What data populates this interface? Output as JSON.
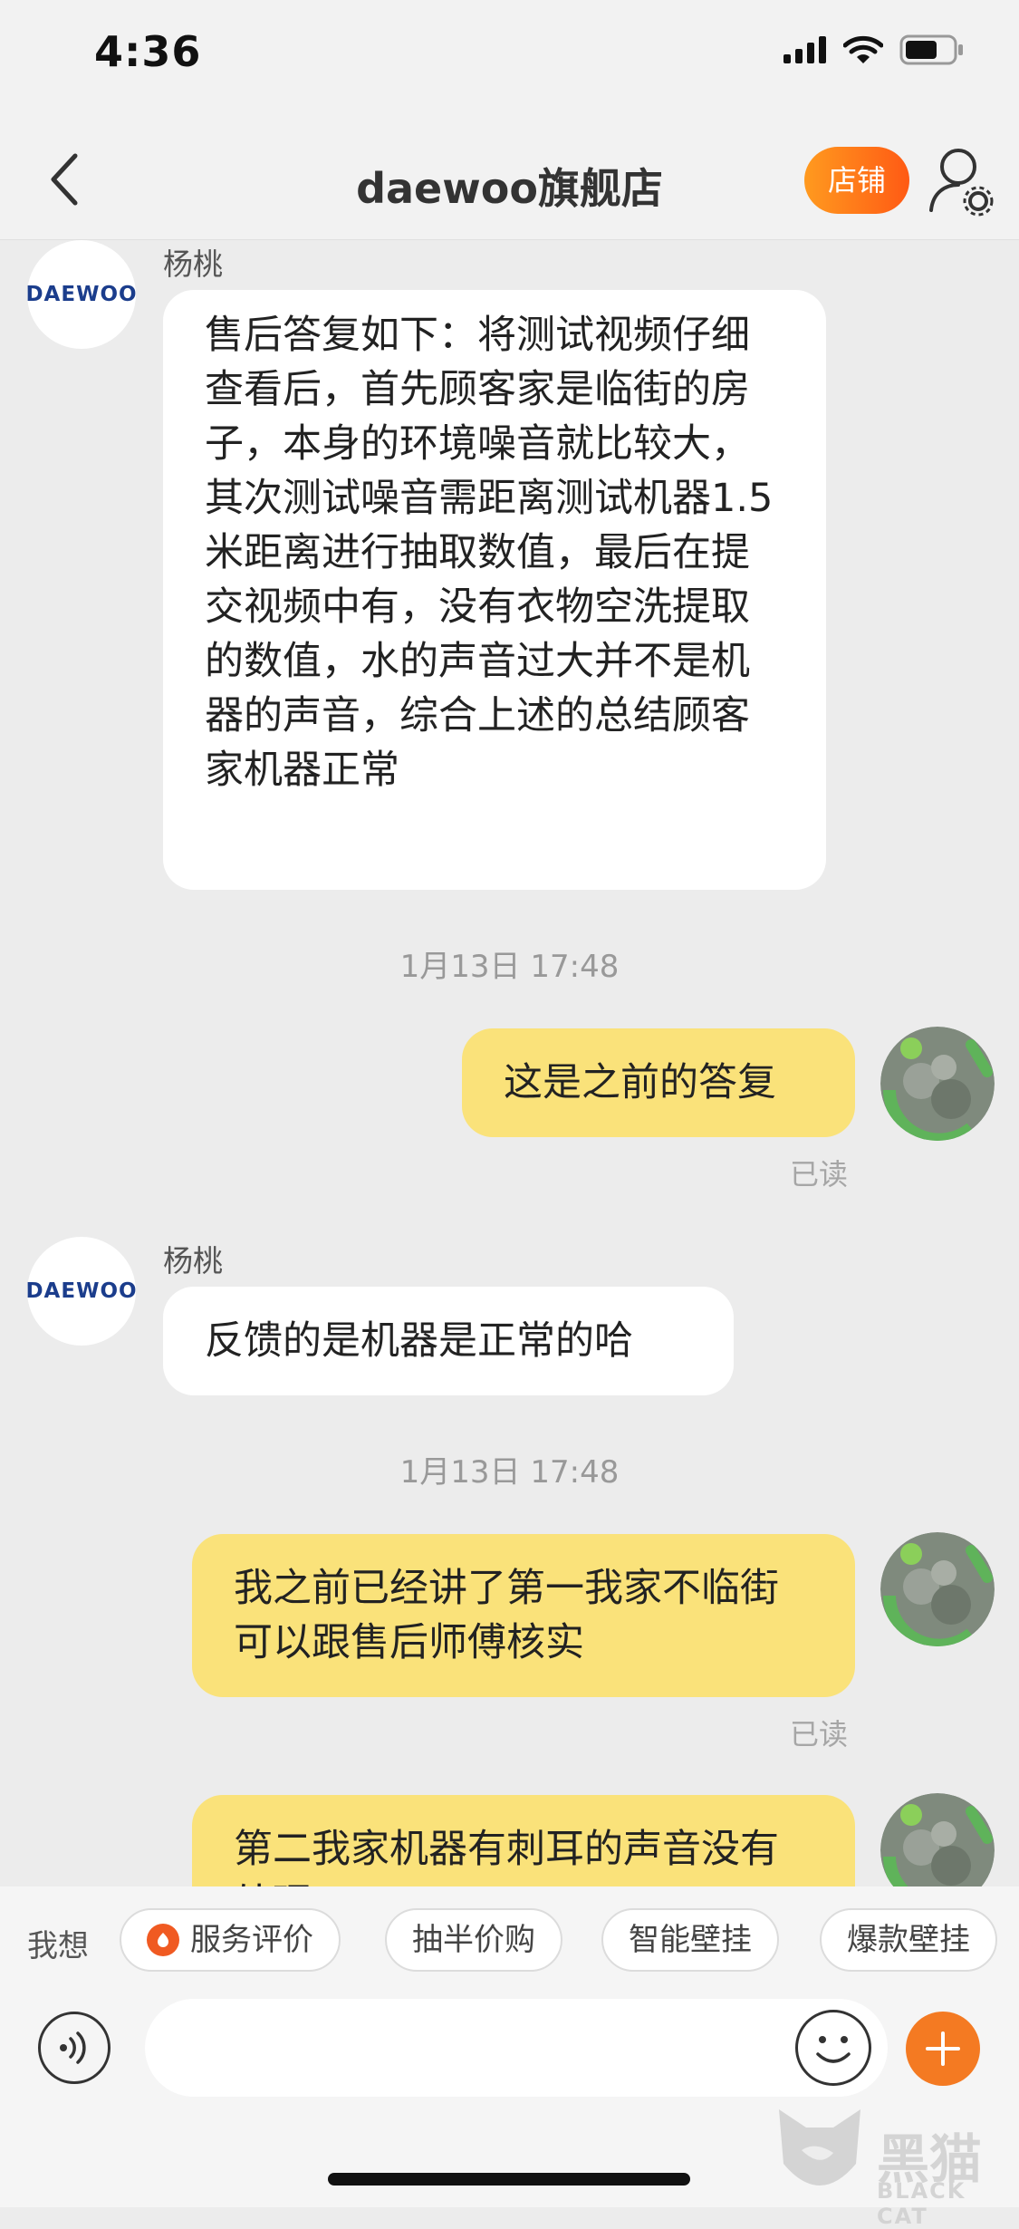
{
  "status_bar": {
    "time": "4:36"
  },
  "nav": {
    "title": "daewoo旗舰店",
    "store_button": "店铺"
  },
  "messages": [
    {
      "sender": "杨桃",
      "avatar_text": "DAEWOO",
      "text": "售后答复如下：将测试视频仔细查看后，首先顾客家是临街的房子，本身的环境噪音就比较大，其次测试噪音需距离测试机器1.5米距离进行抽取数值，最后在提交视频中有，没有衣物空洗提取的数值，水的声音过大并不是机器的声音，综合上述的总结顾客家机器正常"
    },
    {
      "timestamp": "1月13日 17:48"
    },
    {
      "text": "这是之前的答复",
      "read": "已读"
    },
    {
      "sender": "杨桃",
      "avatar_text": "DAEWOO",
      "text": "反馈的是机器是正常的哈"
    },
    {
      "timestamp": "1月13日 17:48"
    },
    {
      "text": "我之前已经讲了第一我家不临街 可以跟售后师傅核实",
      "read": "已读"
    },
    {
      "text": "第二我家机器有刺耳的声音没有处理"
    }
  ],
  "quick_replies": {
    "label": "我想",
    "chips": [
      "服务评价",
      "抽半价购",
      "智能壁挂",
      "爆款壁挂"
    ]
  },
  "input": {
    "placeholder": ""
  },
  "watermark": {
    "text": "黑猫",
    "sub": "BLACK CAT"
  },
  "colors": {
    "accent": "#ff6a1a",
    "outgoing_bubble": "#fae27a",
    "incoming_bubble": "#ffffff",
    "background": "#ececec"
  }
}
